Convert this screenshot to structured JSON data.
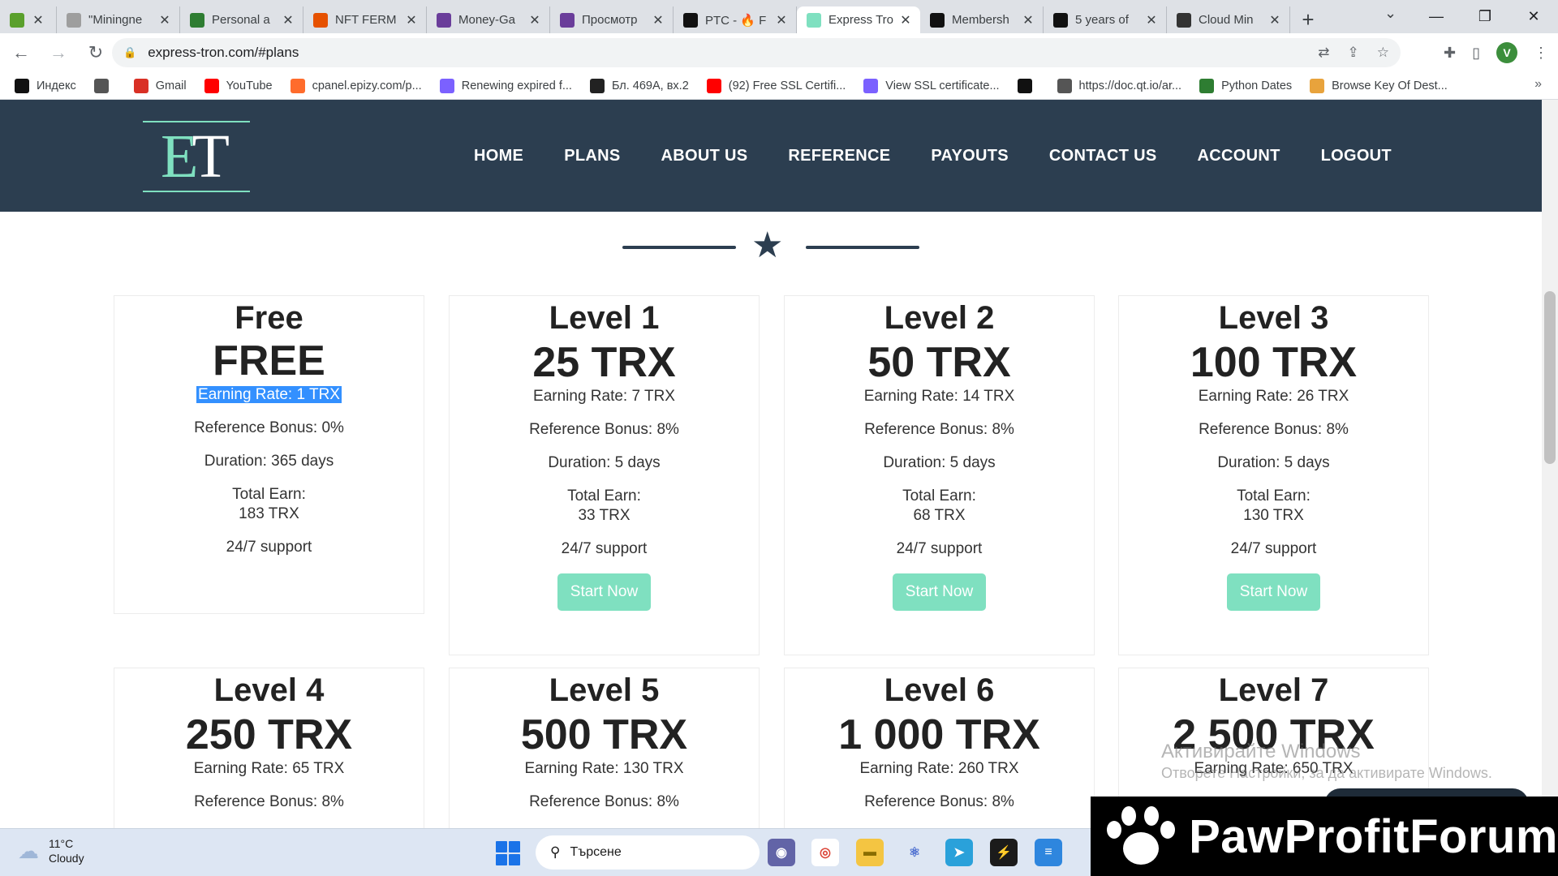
{
  "browser": {
    "tabs": [
      {
        "title": "",
        "color": "#5aa02c",
        "icon": "app-icon"
      },
      {
        "title": "\"Miningne",
        "color": "#9e9e9e",
        "icon": "page-icon"
      },
      {
        "title": "Personal a",
        "color": "#2e7d32",
        "icon": "wallet-icon"
      },
      {
        "title": "NFT FERM",
        "color": "#e65100",
        "icon": "nft-icon"
      },
      {
        "title": "Money-Ga",
        "color": "#6a3d9a",
        "icon": "circle-icon"
      },
      {
        "title": "Просмотр",
        "color": "#6a3d9a",
        "icon": "circle-icon"
      },
      {
        "title": "PTC - 🔥 F",
        "color": "#111111",
        "icon": "f-icon"
      },
      {
        "title": "Express Tro",
        "color": "#7fe0c0",
        "icon": "et-icon"
      },
      {
        "title": "Membersh",
        "color": "#111111",
        "icon": "f-icon"
      },
      {
        "title": "5 years of",
        "color": "#111111",
        "icon": "f-icon"
      },
      {
        "title": "Cloud Min",
        "color": "#333333",
        "icon": "b-icon"
      }
    ],
    "url": "express-tron.com/#plans",
    "bookmarks": [
      {
        "label": "Индекс",
        "color": "#111111",
        "icon": "yandex-icon"
      },
      {
        "label": "",
        "color": "#555555",
        "icon": "globe-icon"
      },
      {
        "label": "Gmail",
        "color": "#d93025",
        "icon": "gmail-icon"
      },
      {
        "label": "YouTube",
        "color": "#ff0000",
        "icon": "youtube-icon"
      },
      {
        "label": "cpanel.epizy.com/p...",
        "color": "#ff6c2c",
        "icon": "cpanel-icon"
      },
      {
        "label": "Renewing expired f...",
        "color": "#7b61ff",
        "icon": "infinity-icon"
      },
      {
        "label": "Бл. 469А, вх.2",
        "color": "#222222",
        "icon": "home-icon"
      },
      {
        "label": "(92) Free SSL Certifi...",
        "color": "#ff0000",
        "icon": "youtube-icon"
      },
      {
        "label": "View SSL certificate...",
        "color": "#7b61ff",
        "icon": "infinity-icon"
      },
      {
        "label": "",
        "color": "#111111",
        "icon": "f-icon"
      },
      {
        "label": "https://doc.qt.io/ar...",
        "color": "#555555",
        "icon": "globe-icon"
      },
      {
        "label": "Python Dates",
        "color": "#2e7d32",
        "icon": "w3-icon"
      },
      {
        "label": "Browse Key Of Dest...",
        "color": "#e8a33c",
        "icon": "shield-icon"
      }
    ],
    "profile_initial": "V"
  },
  "site": {
    "logo_e": "E",
    "logo_t": "T",
    "nav": [
      "HOME",
      "PLANS",
      "ABOUT US",
      "REFERENCE",
      "PAYOUTS",
      "CONTACT US",
      "ACCOUNT",
      "LOGOUT"
    ],
    "plans": [
      {
        "name": "Free",
        "price": "FREE",
        "rate": "Earning Rate: 1 TRX",
        "bonus": "Reference Bonus: 0%",
        "duration": "Duration: 365 days",
        "total_label": "Total Earn:",
        "total": "183 TRX",
        "support": "24/7 support",
        "button": ""
      },
      {
        "name": "Level 1",
        "price": "25 TRX",
        "rate": "Earning Rate: 7 TRX",
        "bonus": "Reference Bonus: 8%",
        "duration": "Duration: 5 days",
        "total_label": "Total Earn:",
        "total": "33 TRX",
        "support": "24/7 support",
        "button": "Start Now"
      },
      {
        "name": "Level 2",
        "price": "50 TRX",
        "rate": "Earning Rate: 14 TRX",
        "bonus": "Reference Bonus: 8%",
        "duration": "Duration: 5 days",
        "total_label": "Total Earn:",
        "total": "68 TRX",
        "support": "24/7 support",
        "button": "Start Now"
      },
      {
        "name": "Level 3",
        "price": "100 TRX",
        "rate": "Earning Rate: 26 TRX",
        "bonus": "Reference Bonus: 8%",
        "duration": "Duration: 5 days",
        "total_label": "Total Earn:",
        "total": "130 TRX",
        "support": "24/7 support",
        "button": "Start Now"
      },
      {
        "name": "Level 4",
        "price": "250 TRX",
        "rate": "Earning Rate: 65 TRX",
        "bonus": "Reference Bonus: 8%"
      },
      {
        "name": "Level 5",
        "price": "500 TRX",
        "rate": "Earning Rate: 130 TRX",
        "bonus": "Reference Bonus: 8%"
      },
      {
        "name": "Level 6",
        "price": "1 000 TRX",
        "rate": "Earning Rate: 260 TRX",
        "bonus": "Reference Bonus: 8%"
      },
      {
        "name": "Level 7",
        "price": "2 500 TRX",
        "rate": "Earning Rate: 650 TRX",
        "bonus": ""
      }
    ],
    "watermark_line1": "Активирайте Windows",
    "watermark_line2": "Отворете Настройки, за да активирате Windows."
  },
  "taskbar": {
    "temperature": "11°C",
    "condition": "Cloudy",
    "search_placeholder": "Търсене"
  },
  "overlay": {
    "brand": "PawProfitForum"
  },
  "colors": {
    "header_bg": "#2c3e50",
    "accent": "#7fe0c0",
    "selection": "#3390ff"
  }
}
